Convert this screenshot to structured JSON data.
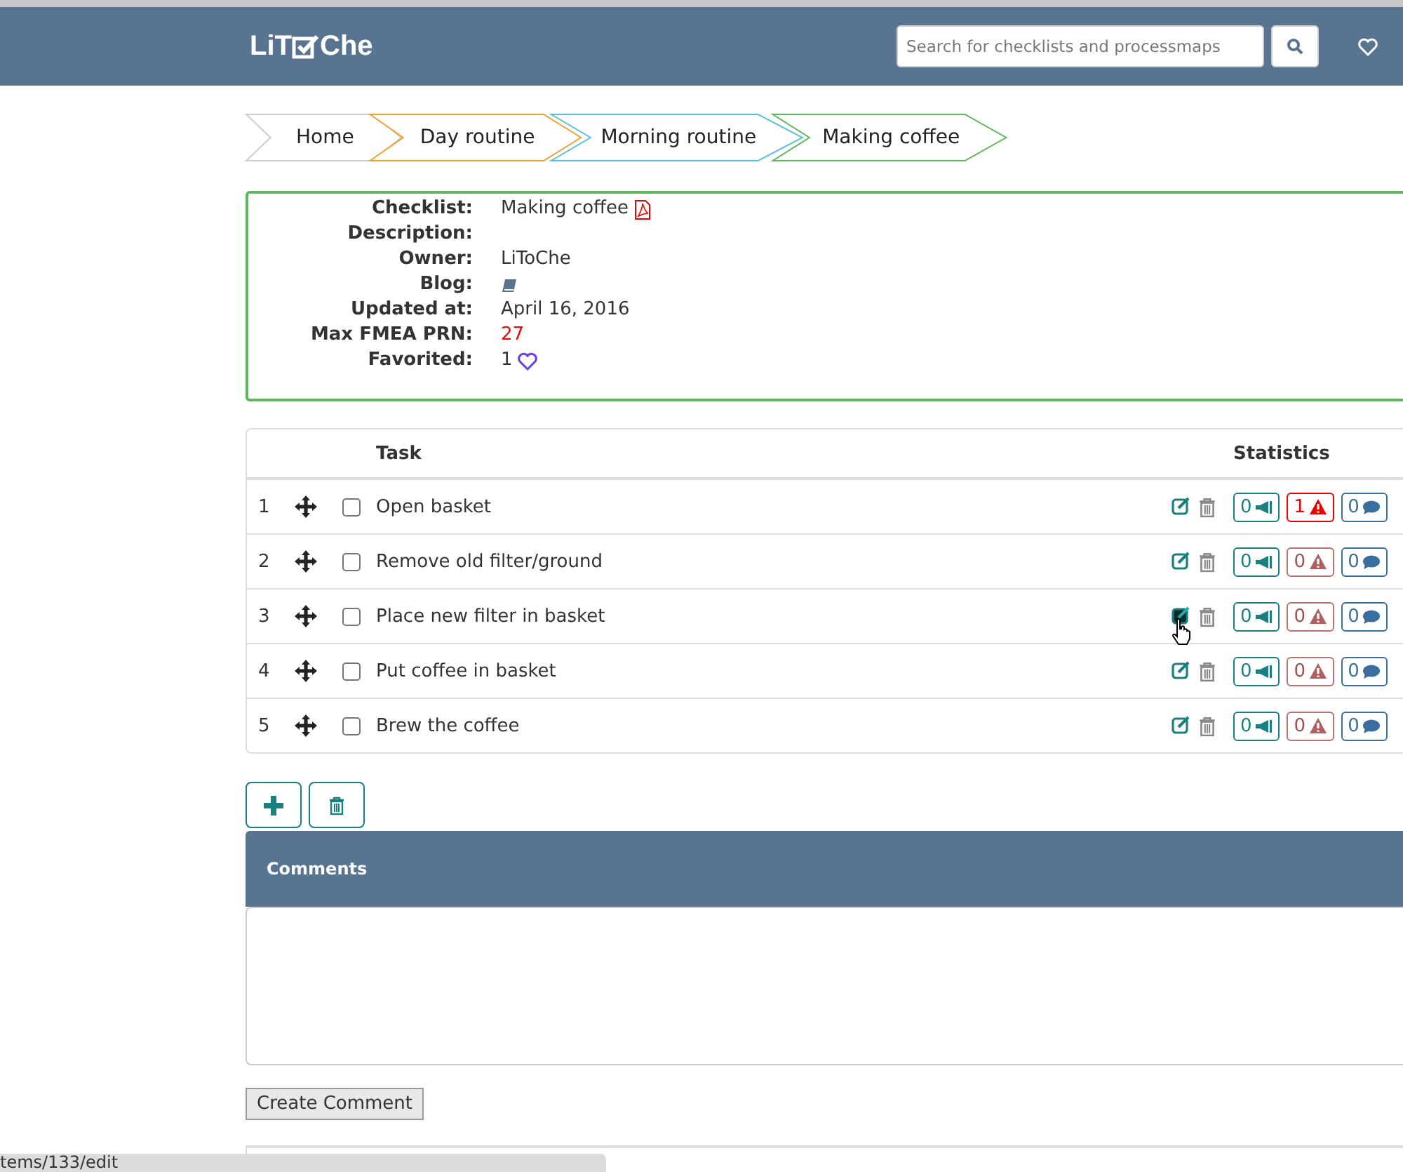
{
  "navbar": {
    "logo_start": "LiT",
    "logo_end": "Che",
    "search": {
      "placeholder": "Search for checklists and processmaps"
    }
  },
  "breadcrumbs": [
    {
      "label": "Home",
      "color": "#cccccc"
    },
    {
      "label": "Day routine",
      "color": "#f0a030"
    },
    {
      "label": "Morning routine",
      "color": "#5bc0de"
    },
    {
      "label": "Making coffee",
      "color": "#5cb85c"
    }
  ],
  "info": {
    "fields": [
      {
        "label": "Checklist:",
        "value": "Making coffee",
        "kind": "pdf"
      },
      {
        "label": "Description:",
        "kind": "text"
      },
      {
        "label": "Owner:",
        "value": "LiToChe",
        "kind": "text"
      },
      {
        "label": "Blog:",
        "kind": "book"
      },
      {
        "label": "Updated at:",
        "value": "April 16, 2016",
        "kind": "text"
      },
      {
        "label": "Max FMEA PRN:",
        "value": "27",
        "kind": "alert"
      },
      {
        "label": "Favorited:",
        "value": "1",
        "kind": "heart"
      }
    ]
  },
  "table": {
    "columns": [
      "Task",
      "Statistics"
    ],
    "rows": [
      {
        "number": "1",
        "task": "Open basket",
        "checked": false,
        "hovered": false,
        "notes": "0",
        "risks": "1",
        "risk_alert": true,
        "comments": "0"
      },
      {
        "number": "2",
        "task": "Remove old filter/ground",
        "checked": false,
        "hovered": false,
        "notes": "0",
        "risks": "0",
        "risk_alert": false,
        "comments": "0"
      },
      {
        "number": "3",
        "task": "Place new filter in basket",
        "checked": false,
        "hovered": true,
        "notes": "0",
        "risks": "0",
        "risk_alert": false,
        "comments": "0"
      },
      {
        "number": "4",
        "task": "Put coffee in basket",
        "checked": false,
        "hovered": false,
        "notes": "0",
        "risks": "0",
        "risk_alert": false,
        "comments": "0"
      },
      {
        "number": "5",
        "task": "Brew the coffee",
        "checked": false,
        "hovered": false,
        "notes": "0",
        "risks": "0",
        "risk_alert": false,
        "comments": "0"
      }
    ]
  },
  "comments": {
    "title": "Comments",
    "submit": "Create Comment"
  },
  "status_bar": {
    "url": "tems/133/edit"
  }
}
